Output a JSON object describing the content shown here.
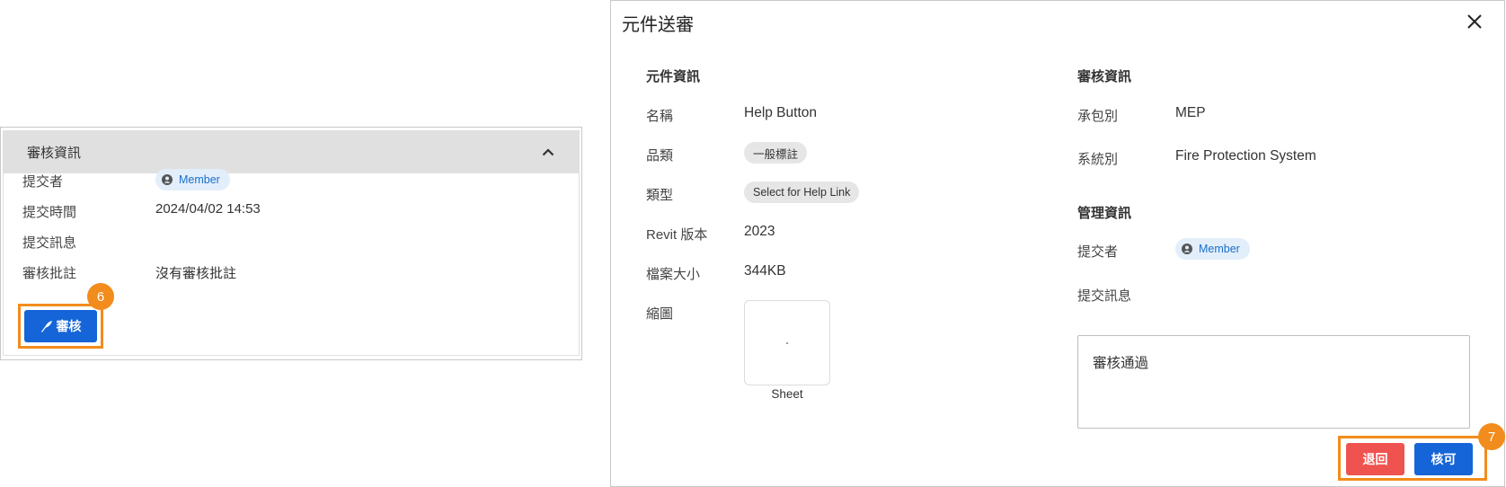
{
  "left_card": {
    "header_title": "審核資訊",
    "rows": [
      {
        "label": "提交者",
        "value": "Member"
      },
      {
        "label": "提交時間",
        "value": "2024/04/02 14:53"
      },
      {
        "label": "提交訊息",
        "value": ""
      },
      {
        "label": "審核批註",
        "value": "沒有審核批註"
      }
    ],
    "review_button_label": "審核",
    "step_badge": "6"
  },
  "dialog": {
    "title": "元件送審",
    "component_section": {
      "title": "元件資訊",
      "name_label": "名稱",
      "name_value": "Help Button",
      "category_label": "品類",
      "category_value": "一般標註",
      "type_label": "類型",
      "type_value": "Select for Help Link",
      "revit_label": "Revit 版本",
      "revit_value": "2023",
      "size_label": "檔案大小",
      "size_value": "344KB",
      "thumb_label": "縮圖",
      "thumb_caption": "Sheet"
    },
    "review_section": {
      "title": "審核資訊",
      "contractor_label": "承包別",
      "contractor_value": "MEP",
      "system_label": "系統別",
      "system_value": "Fire Protection System"
    },
    "manage_section": {
      "title": "管理資訊",
      "submitter_label": "提交者",
      "submitter_value": "Member",
      "message_label": "提交訊息"
    },
    "comment_value": "審核通過",
    "reject_label": "退回",
    "approve_label": "核可",
    "step_badge": "7"
  },
  "colors": {
    "primary": "#1565d8",
    "danger": "#ef5350",
    "highlight": "#f28c1c",
    "header_bg": "#e0e0e0",
    "chip_bg": "#e3eefb"
  },
  "icons": [
    "chevron-up-icon",
    "account-circle-icon",
    "feather-icon",
    "close-icon"
  ]
}
